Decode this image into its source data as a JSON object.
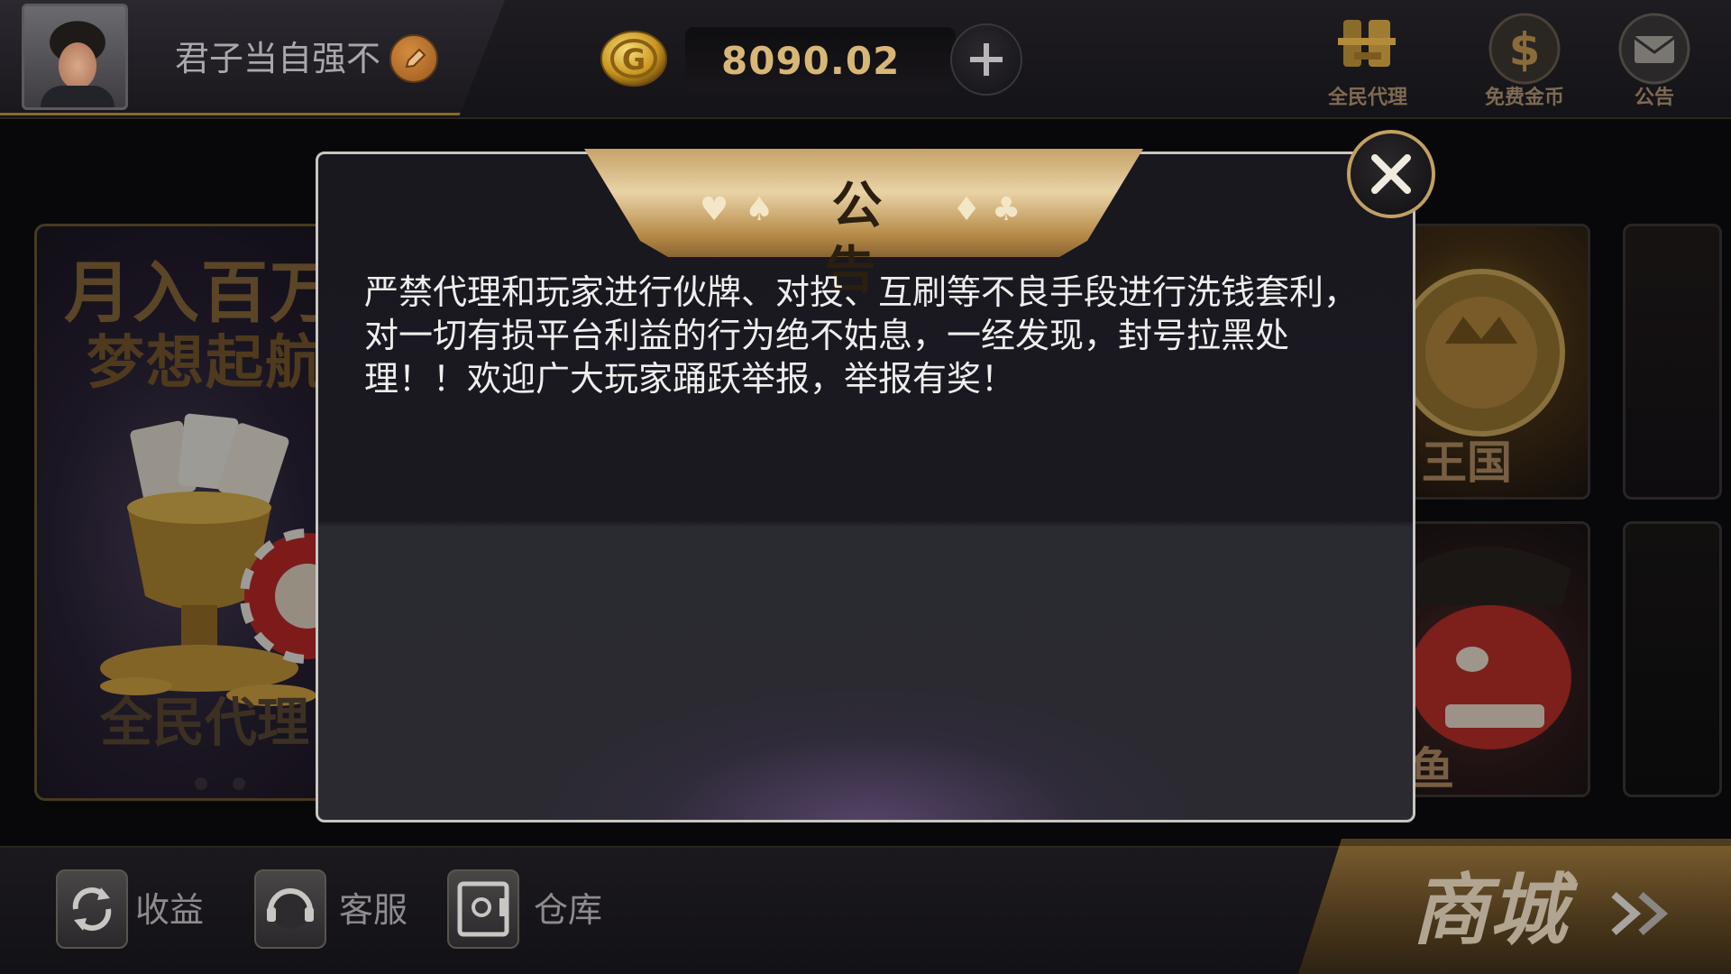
{
  "profile": {
    "nickname": "君子当自强不"
  },
  "wallet": {
    "balance": "8090.02"
  },
  "top_icons": [
    {
      "caption": "全民代理",
      "icon": "agent-icon"
    },
    {
      "caption": "免费金币",
      "icon": "dollar-coin-icon"
    },
    {
      "caption": "公告",
      "icon": "mail-icon"
    }
  ],
  "banner": {
    "line1": "月入百万",
    "line2": "梦想起航",
    "footer": "全民代理",
    "page_count": 2
  },
  "game_tiles": [
    {
      "label": "王国"
    },
    {
      "label": "鱼"
    }
  ],
  "bottom_bar": {
    "items": [
      {
        "label": "收益",
        "icon": "refresh-icon"
      },
      {
        "label": "客服",
        "icon": "headset-icon"
      },
      {
        "label": "仓库",
        "icon": "safe-icon"
      }
    ],
    "shop_label": "商城"
  },
  "modal": {
    "title": "公告",
    "suits_left": [
      "♥",
      "♠"
    ],
    "suits_right": [
      "♦",
      "♣"
    ],
    "body": "严禁代理和玩家进行伙牌、对投、互刷等不良手段进行洗钱套利，对一切有损平台利益的行为绝不姑息，一经发现，封号拉黑处理！！欢迎广大玩家踊跃举报，举报有奖！"
  },
  "colors": {
    "gold": "#d8b776",
    "modal_border": "#c9c6c0",
    "close_ring": "#c2a063"
  }
}
